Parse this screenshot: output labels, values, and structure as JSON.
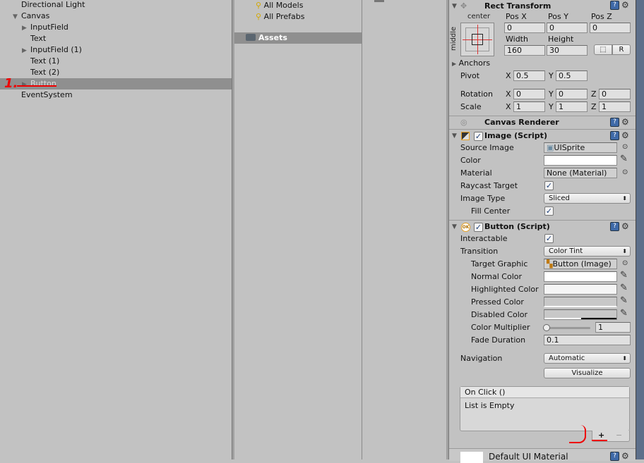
{
  "hierarchy": {
    "items": [
      {
        "label": "Directional Light",
        "indent": 0,
        "arrow": ""
      },
      {
        "label": "Canvas",
        "indent": 0,
        "arrow": "down"
      },
      {
        "label": "InputField",
        "indent": 1,
        "arrow": "right"
      },
      {
        "label": "Text",
        "indent": 1,
        "arrow": ""
      },
      {
        "label": "InputField (1)",
        "indent": 1,
        "arrow": "right"
      },
      {
        "label": "Text (1)",
        "indent": 1,
        "arrow": ""
      },
      {
        "label": "Text (2)",
        "indent": 1,
        "arrow": ""
      },
      {
        "label": "Button",
        "indent": 1,
        "arrow": "right",
        "selected": true
      },
      {
        "label": "EventSystem",
        "indent": 0,
        "arrow": ""
      }
    ],
    "annotation": "1."
  },
  "project": {
    "favorites": [
      "All Models",
      "All Prefabs"
    ],
    "assets_label": "Assets"
  },
  "inspector": {
    "rect_transform": {
      "title": "Rect Transform",
      "anchor_h": "center",
      "anchor_v": "middle",
      "pos_x_label": "Pos X",
      "pos_y_label": "Pos Y",
      "pos_z_label": "Pos Z",
      "pos_x": "0",
      "pos_y": "0",
      "pos_z": "0",
      "width_label": "Width",
      "height_label": "Height",
      "width": "160",
      "height": "30",
      "r_button": "R",
      "anchors_label": "Anchors",
      "pivot_label": "Pivot",
      "pivot_x": "0.5",
      "pivot_y": "0.5",
      "rotation_label": "Rotation",
      "rot_x": "0",
      "rot_y": "0",
      "rot_z": "0",
      "scale_label": "Scale",
      "scale_x": "1",
      "scale_y": "1",
      "scale_z": "1",
      "x": "X",
      "y": "Y",
      "z": "Z"
    },
    "canvas_renderer": {
      "title": "Canvas Renderer"
    },
    "image": {
      "title": "Image (Script)",
      "enabled": true,
      "source_image_label": "Source Image",
      "source_image": "UISprite",
      "color_label": "Color",
      "color": "#ffffff",
      "material_label": "Material",
      "material": "None (Material)",
      "raycast_label": "Raycast Target",
      "raycast": true,
      "image_type_label": "Image Type",
      "image_type": "Sliced",
      "fill_center_label": "Fill Center",
      "fill_center": true
    },
    "button": {
      "title": "Button (Script)",
      "enabled": true,
      "interactable_label": "Interactable",
      "interactable": true,
      "transition_label": "Transition",
      "transition": "Color Tint",
      "target_graphic_label": "Target Graphic",
      "target_graphic": "Button (Image)",
      "normal_label": "Normal Color",
      "normal": "#ffffff",
      "highlighted_label": "Highlighted Color",
      "highlighted": "#f5f5f5",
      "pressed_label": "Pressed Color",
      "pressed": "#c8c8c8",
      "disabled_label": "Disabled Color",
      "disabled": "#c8c8c8",
      "multiplier_label": "Color Multiplier",
      "multiplier": "1",
      "fade_label": "Fade Duration",
      "fade": "0.1",
      "navigation_label": "Navigation",
      "navigation": "Automatic",
      "visualize": "Visualize",
      "onclick_title": "On Click ()",
      "onclick_empty": "List is Empty",
      "add": "+",
      "remove": "−"
    },
    "material": {
      "title": "Default UI Material"
    }
  }
}
